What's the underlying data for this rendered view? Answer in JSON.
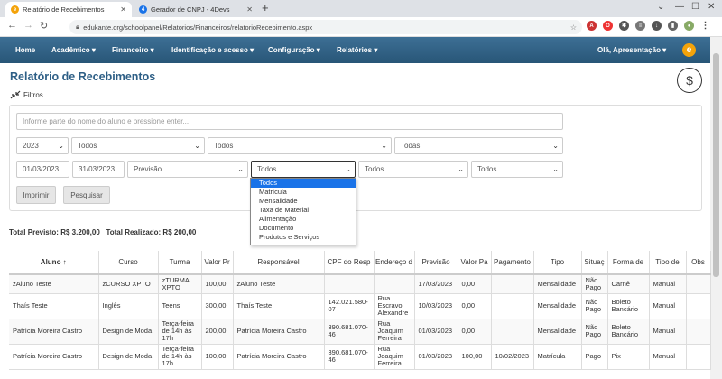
{
  "browser": {
    "tabs": [
      {
        "title": "Relatório de Recebimentos",
        "fav_color": "#f4a30a"
      },
      {
        "title": "Gerador de CNPJ - 4Devs",
        "fav_color": "#1a73e8"
      }
    ],
    "url": "edukante.org/schoolpanel/Relatorios/Financeiros/relatorioRecebimento.aspx"
  },
  "nav": {
    "items": [
      "Home",
      "Acadêmico ▾",
      "Financeiro ▾",
      "Identificação e acesso ▾",
      "Configuração ▾",
      "Relatórios ▾"
    ],
    "user": "Olá, Apresentação ▾",
    "logo_letter": "e",
    "bg": "#2f6388"
  },
  "page": {
    "title": "Relatório de Recebimentos",
    "filtros_label": "Filtros",
    "dollar": "$"
  },
  "filters": {
    "search_placeholder": "Informe parte do nome do aluno e pressione enter...",
    "year": "2023",
    "sel1": "Todos",
    "sel2": "Todos",
    "sel3": "Todas",
    "date_from": "01/03/2023",
    "date_to": "31/03/2023",
    "previsao": "Previsão",
    "sel4": "Todos",
    "sel5": "Todos",
    "sel6": "Todos",
    "imprimir": "Imprimir",
    "pesquisar": "Pesquisar"
  },
  "dropdown": {
    "options": [
      "Todos",
      "Matrícula",
      "Mensalidade",
      "Taxa de Material",
      "Alimentação",
      "Documento",
      "Produtos e Serviços"
    ]
  },
  "totals": {
    "text": "Total Previsto: R$ 3.200,00   Total Realizado: R$ 200,00"
  },
  "table": {
    "headers": [
      "Aluno ↑",
      "Curso",
      "Turma",
      "Valor Pr",
      "Responsável",
      "CPF do Resp",
      "Endereço d",
      "Previsão",
      "Valor Pa",
      "Pagamento",
      "Tipo",
      "Situaç",
      "Forma de",
      "Tipo de",
      "Obs"
    ],
    "rows": [
      [
        "zAluno Teste",
        "zCURSO XPTO",
        "zTURMA XPTO",
        "100,00",
        "zAluno Teste",
        "",
        "",
        "17/03/2023",
        "0,00",
        "",
        "Mensalidade",
        "Não Pago",
        "Carnê",
        "Manual",
        ""
      ],
      [
        "Thaís Teste",
        "Inglês",
        "Teens",
        "300,00",
        "Thaís Teste",
        "142.021.580-07",
        "Rua Escravo Alexandre",
        "10/03/2023",
        "0,00",
        "",
        "Mensalidade",
        "Não Pago",
        "Boleto Bancário",
        "Manual",
        ""
      ],
      [
        "Patrícia Moreira Castro",
        "Design de Moda",
        "Terça-feira de 14h às 17h",
        "200,00",
        "Patrícia Moreira Castro",
        "390.681.070-46",
        "Rua Joaquim Ferreira",
        "01/03/2023",
        "0,00",
        "",
        "Mensalidade",
        "Não Pago",
        "Boleto Bancário",
        "Manual",
        ""
      ],
      [
        "Patrícia Moreira Castro",
        "Design de Moda",
        "Terça-feira de 14h às 17h",
        "100,00",
        "Patrícia Moreira Castro",
        "390.681.070-46",
        "Rua Joaquim Ferreira",
        "01/03/2023",
        "100,00",
        "10/02/2023",
        "Matrícula",
        "Pago",
        "Pix",
        "Manual",
        ""
      ]
    ]
  }
}
